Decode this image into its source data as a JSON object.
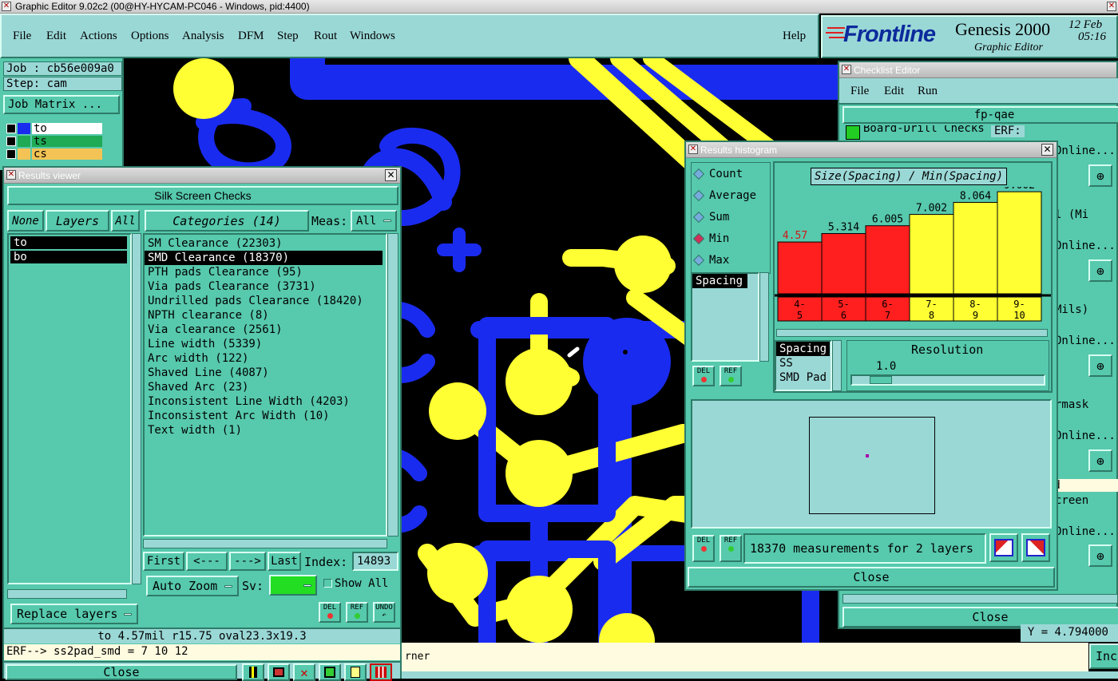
{
  "app": {
    "title": "Graphic Editor 9.02c2 (00@HY-HYCAM-PC046 - Windows, pid:4400)",
    "menu": [
      "File",
      "Edit",
      "Actions",
      "Options",
      "Analysis",
      "DFM",
      "Step",
      "Rout",
      "Windows"
    ],
    "help": "Help",
    "brand": "Frontline",
    "product": "Genesis 2000",
    "subtitle": "Graphic Editor",
    "date": "12 Feb",
    "time": "05:16"
  },
  "job": {
    "job": "Job : cb56e009a0",
    "step": "Step: cam",
    "matrix": "Job Matrix ...",
    "layers": [
      {
        "name": "to",
        "color": "#ffffff"
      },
      {
        "name": "ts",
        "color": "#1faa55"
      },
      {
        "name": "cs",
        "color": "#f3c455"
      }
    ]
  },
  "results": {
    "title": "Results viewer",
    "header": "Silk Screen Checks",
    "none": "None",
    "layers": "Layers",
    "all": "All",
    "categories_btn": "Categories (14)",
    "meas_label": "Meas:",
    "meas_value": "All",
    "layer_list": [
      "to",
      "bo"
    ],
    "categories": [
      "SM Clearance (22303)",
      "SMD Clearance (18370)",
      "PTH pads Clearance (95)",
      "Via pads Clearance (3731)",
      "Undrilled pads Clearance (18420)",
      "NPTH clearance (8)",
      "Via clearance (2561)",
      "Line width (5339)",
      "Arc width (122)",
      "Shaved Line (4087)",
      "Shaved Arc (23)",
      "Inconsistent Line Width (4203)",
      "Inconsistent Arc Width (10)",
      "Text width (1)"
    ],
    "selected": 1,
    "first": "First",
    "prev": "<---",
    "next": "--->",
    "last": "Last",
    "index_label": "Index:",
    "index_value": "14893",
    "auto_zoom": "Auto Zoom",
    "sv": "Sv:",
    "show_all": "Show All",
    "replace_layers": "Replace layers",
    "del": "DEL",
    "ref": "REF",
    "undo": "UNDO",
    "status": "to 4.57mil r15.75 oval23.3x19.3",
    "erf": "ERF--> ss2pad_smd = 7 10 12",
    "close": "Close"
  },
  "histogram": {
    "title": "Results histogram",
    "modes": [
      "Count",
      "Average",
      "Sum",
      "Min",
      "Max"
    ],
    "selected_mode": "Min",
    "list": [
      "Spacing"
    ],
    "chart_title": "Size(Spacing) / Min(Spacing)",
    "bins": [
      "4-\n5",
      "5-\n6",
      "6-\n7",
      "7-\n8",
      "8-\n9",
      "9-\n10"
    ],
    "values": [
      4.57,
      5.314,
      6.005,
      7.002,
      8.064,
      9.002
    ],
    "value_labels": [
      "4.57",
      "5.314",
      "6.005",
      "7.002",
      "8.064",
      "9.002"
    ],
    "bar_colors": [
      "#ff1f1f",
      "#ff1f1f",
      "#ff1f1f",
      "#ffff33",
      "#ffff33",
      "#ffff33"
    ],
    "label_colors": [
      "#d01818",
      "#000000",
      "#000000",
      "#000000",
      "#000000",
      "#000000"
    ],
    "sublist": [
      "Spacing",
      "SS",
      "SMD Pad"
    ],
    "resolution_label": "Resolution",
    "resolution_value": "1.0",
    "del": "DEL",
    "ref": "REF",
    "measurements": "18370 measurements for 2 layers",
    "close": "Close"
  },
  "checklist": {
    "title": "Checklist Editor",
    "menu": [
      "File",
      "Edit",
      "Run"
    ],
    "name": "fp-qae",
    "row1": "Board-Drill Checks",
    "erf": "ERF:",
    "right_labels": [
      "Online...",
      "l (Mi",
      "Online...",
      "Mils)",
      "Online...",
      "rmask",
      "Online...",
      "ed",
      "creen",
      "Online..."
    ],
    "close": "Close",
    "coord": "Y = 4.794000"
  },
  "bottom": {
    "text": "rner",
    "inc": "Inc"
  }
}
